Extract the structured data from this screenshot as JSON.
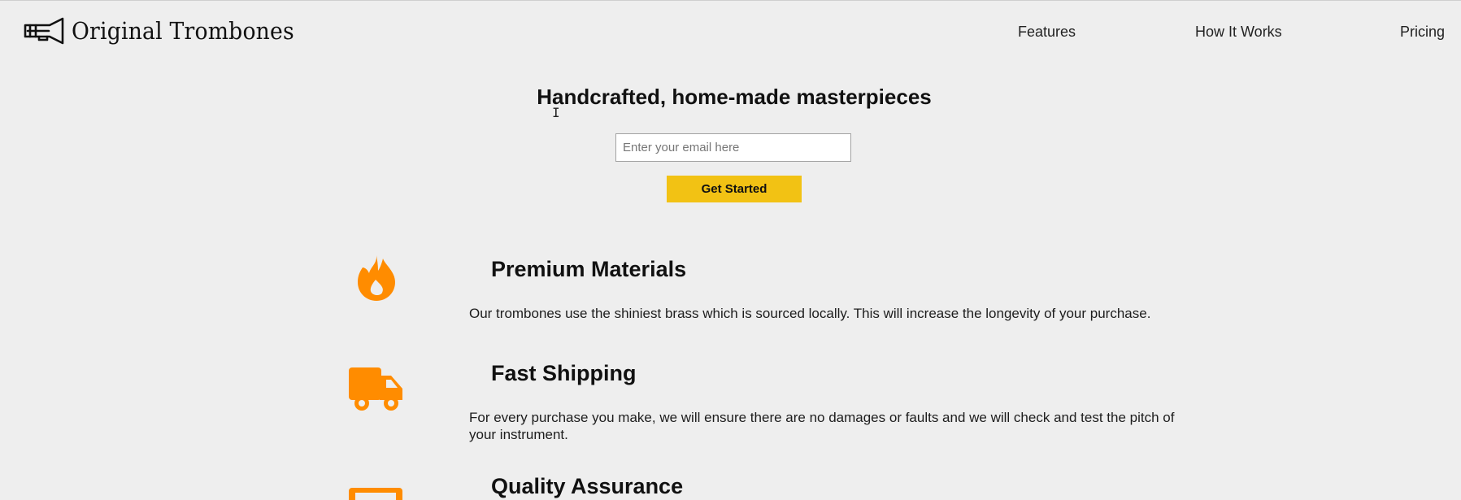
{
  "brand": {
    "name": "Original Trombones",
    "logo_icon": "trombone-icon"
  },
  "nav": {
    "items": [
      {
        "label": "Features"
      },
      {
        "label": "How It Works"
      },
      {
        "label": "Pricing"
      }
    ]
  },
  "hero": {
    "title": "Handcrafted, home-made masterpieces",
    "email_placeholder": "Enter your email here",
    "email_value": "",
    "cta_label": "Get Started"
  },
  "features": [
    {
      "icon": "fire-icon",
      "title": "Premium Materials",
      "description": "Our trombones use the shiniest brass which is sourced locally. This will increase the longevity of your purchase."
    },
    {
      "icon": "truck-icon",
      "title": "Fast Shipping",
      "description": "For every purchase you make, we will ensure there are no damages or faults and we will check and test the pitch of your instrument."
    },
    {
      "icon": "certificate-icon",
      "title": "Quality Assurance",
      "description": ""
    }
  ],
  "colors": {
    "background": "#eeeeee",
    "accent_orange": "#ff8c00",
    "cta_yellow": "#f2c214",
    "text": "#111111"
  }
}
